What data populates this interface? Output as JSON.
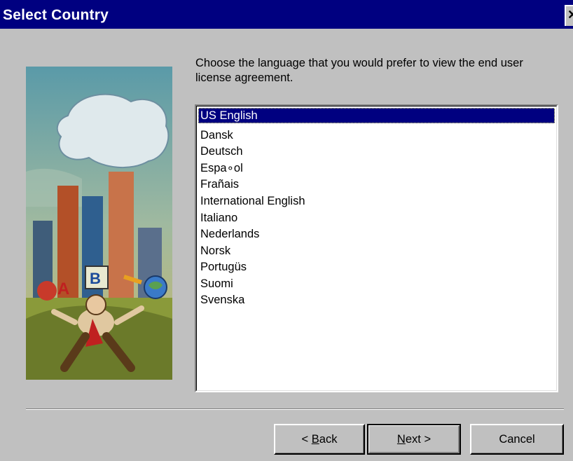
{
  "window": {
    "title": "Select Country",
    "close_glyph": "✕"
  },
  "instruction": "Choose the language that you would prefer to view the end user license agreement.",
  "languages": [
    "US English",
    "Dansk",
    "Deutsch",
    "Espa∘ol",
    "Frañais",
    "International English",
    "Italiano",
    "Nederlands",
    "Norsk",
    "Portugüs",
    "Suomi",
    "Svenska"
  ],
  "selected_language": "US English",
  "buttons": {
    "back": {
      "prefix": "< ",
      "accel": "B",
      "rest": "ack"
    },
    "next": {
      "accel": "N",
      "rest": "ext >"
    },
    "cancel": {
      "label": "Cancel"
    }
  },
  "illustration": {
    "icon": "city-runner-illustration",
    "letters": [
      "A",
      "B"
    ]
  }
}
